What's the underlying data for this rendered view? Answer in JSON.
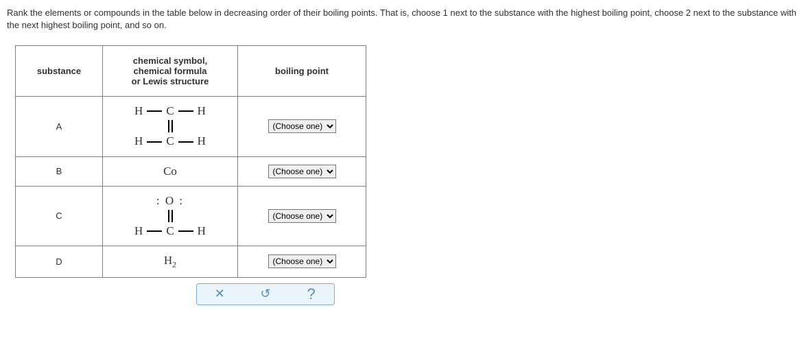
{
  "instructions": "Rank the elements or compounds in the table below in decreasing order of their boiling points. That is, choose 1 next to the substance with the highest boiling point, choose 2 next to the substance with the next highest boiling point, and so on.",
  "headers": {
    "substance": "substance",
    "chemical": "chemical symbol,\nchemical formula\nor Lewis structure",
    "boiling": "boiling point"
  },
  "rows": {
    "A": {
      "label": "A",
      "select_placeholder": "(Choose one)"
    },
    "B": {
      "label": "B",
      "chem_text": "Co",
      "select_placeholder": "(Choose one)"
    },
    "C": {
      "label": "C",
      "select_placeholder": "(Choose one)"
    },
    "D": {
      "label": "D",
      "chem_text": "H",
      "chem_sub": "2",
      "select_placeholder": "(Choose one)"
    }
  },
  "lewis": {
    "H": "H",
    "C": "C",
    "O_lone": ": O :"
  },
  "toolbar": {
    "clear": "✕",
    "reset": "↺",
    "help": "?"
  }
}
